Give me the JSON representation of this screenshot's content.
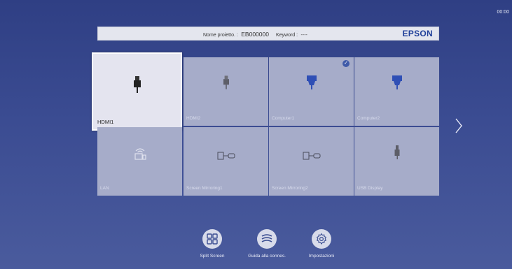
{
  "clock": "00:00",
  "header": {
    "project_label": "Nome proietto. :",
    "project_value": "EB000000",
    "keyword_label": "Keyword :",
    "keyword_value": "----",
    "brand": "EPSON"
  },
  "sources": [
    {
      "name": "HDMI1",
      "icon": "hdmi-plug-icon",
      "selected": true
    },
    {
      "name": "HDMI2",
      "icon": "hdmi-plug-icon"
    },
    {
      "name": "Computer1",
      "icon": "vga-connector-icon",
      "active": true
    },
    {
      "name": "Computer2",
      "icon": "vga-connector-icon"
    },
    {
      "name": "LAN",
      "icon": "lan-wifi-icon"
    },
    {
      "name": "Screen Mirroring1",
      "icon": "screen-mirroring-icon"
    },
    {
      "name": "Screen Mirroring2",
      "icon": "screen-mirroring-icon"
    },
    {
      "name": "USB Display",
      "icon": "usb-plug-icon"
    }
  ],
  "bottom_buttons": [
    {
      "label": "Split Screen",
      "icon": "split-screen-icon"
    },
    {
      "label": "Guida alla connes.",
      "icon": "connection-guide-icon"
    },
    {
      "label": "Impostazioni",
      "icon": "settings-gear-icon"
    }
  ],
  "colors": {
    "background": "#3b4c92",
    "tile": "#a6acc9",
    "tile_selected": "#e4e4ef",
    "brand": "#1f3f99"
  }
}
